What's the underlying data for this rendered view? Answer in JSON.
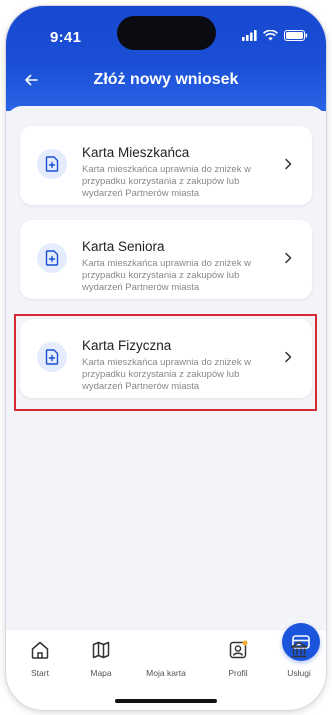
{
  "status": {
    "time": "9:41"
  },
  "header": {
    "title": "Złóż nowy wniosek"
  },
  "cards": [
    {
      "title": "Karta Mieszkańca",
      "description": "Karta mieszkańca uprawnia do zniżek w przypadku korzystania z zakupów lub wydarzeń Partnerów miasta",
      "icon": "document-add-icon"
    },
    {
      "title": "Karta Seniora",
      "description": "Karta mieszkańca uprawnia do zniżek w przypadku korzystania z zakupów lub wydarzeń Partnerów miasta",
      "icon": "document-add-icon"
    },
    {
      "title": "Karta Fizyczna",
      "description": "Karta mieszkańca uprawnia do zniżek w przypadku korzystania z zakupów lub wydarzeń Partnerów miasta",
      "icon": "document-add-icon",
      "highlighted": true
    }
  ],
  "tabbar": {
    "items": [
      {
        "label": "Start",
        "icon": "home-icon"
      },
      {
        "label": "Mapa",
        "icon": "map-icon"
      },
      {
        "label": "Moja karta",
        "icon": "card-icon"
      },
      {
        "label": "Profil",
        "icon": "profile-icon"
      },
      {
        "label": "Usługi",
        "icon": "institution-icon"
      }
    ]
  },
  "colors": {
    "primary": "#1a4fd6",
    "highlight": "#d42a36",
    "icon_bg": "#e4ecfd",
    "background": "#f3f4f8"
  }
}
